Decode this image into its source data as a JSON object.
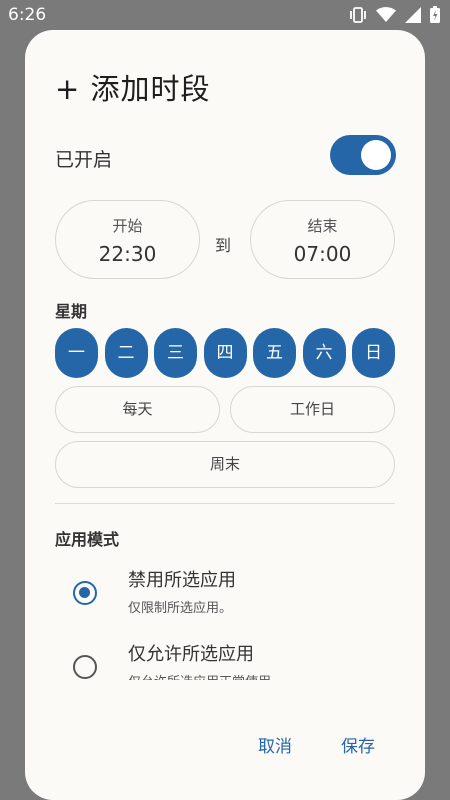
{
  "status_bar": {
    "time": "6:26",
    "icons": [
      "vibrate-icon",
      "wifi-icon",
      "signal-icon",
      "battery-icon"
    ]
  },
  "dialog": {
    "title": "+ 添加时段",
    "enabled_label": "已开启",
    "enabled": true,
    "start": {
      "caption": "开始",
      "value": "22:30"
    },
    "to_label": "到",
    "end": {
      "caption": "结束",
      "value": "07:00"
    },
    "week_label": "星期",
    "days": [
      {
        "label": "一",
        "selected": true
      },
      {
        "label": "二",
        "selected": true
      },
      {
        "label": "三",
        "selected": true
      },
      {
        "label": "四",
        "selected": true
      },
      {
        "label": "五",
        "selected": true
      },
      {
        "label": "六",
        "selected": true
      },
      {
        "label": "日",
        "selected": true
      }
    ],
    "presets": {
      "everyday": "每天",
      "workdays": "工作日",
      "weekend": "周末"
    },
    "mode_label": "应用模式",
    "modes": [
      {
        "title": "禁用所选应用",
        "subtitle": "仅限制所选应用。",
        "selected": true
      },
      {
        "title": "仅允许所选应用",
        "subtitle": "仅允许所选应用正常使用",
        "selected": false
      }
    ],
    "cancel_label": "取消",
    "save_label": "保存"
  },
  "colors": {
    "accent": "#2566a8",
    "dialog_bg": "#fbfaf7",
    "scrim": "#7a7a7a"
  }
}
